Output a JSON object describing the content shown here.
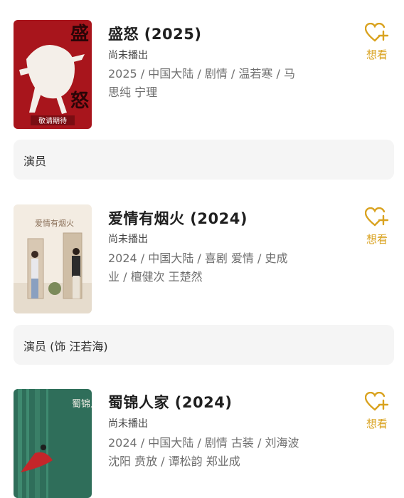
{
  "items": [
    {
      "poster_caption": "敬请期待",
      "poster_title_chars": [
        "盛",
        "怒"
      ],
      "title": "盛怒 (2025)",
      "status": "尚未播出",
      "meta_line1": "2025 / 中国大陆 / 剧情 / 温若寒 / 马",
      "meta_line2": "思纯 宁理",
      "wish_label": "想看",
      "cast_label": "演员"
    },
    {
      "poster_title": "爱情有烟火",
      "title": "爱情有烟火 (2024)",
      "status": "尚未播出",
      "meta_line1": "2024 / 中国大陆 / 喜剧 爱情 / 史成",
      "meta_line2": "业 / 檀健次 王楚然",
      "wish_label": "想看",
      "cast_label": "演员 (饰 汪若海)"
    },
    {
      "poster_title": "蜀锦人家",
      "title": "蜀锦人家 (2024)",
      "status": "尚未播出",
      "meta_line1": "2024 / 中国大陆 / 剧情 古装 / 刘海波",
      "meta_line2": "沈阳 贲放 / 谭松韵 郑业成",
      "wish_label": "想看"
    }
  ],
  "colors": {
    "accent": "#d9a21f",
    "poster1_bg": "#a8151c",
    "poster3_bg": "#2f6e5a"
  },
  "icons": {
    "wish": "heart-plus-icon"
  }
}
